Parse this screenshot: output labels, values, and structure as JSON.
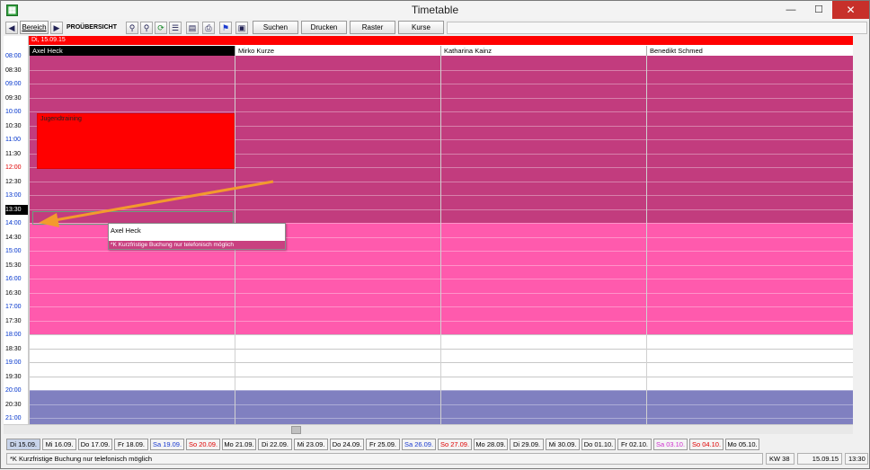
{
  "window": {
    "title": "Timetable",
    "icon": "app-grid-icon",
    "close_color": "#c7302a"
  },
  "toolbar": {
    "bereich": "Bereich",
    "mode": "PROÜBERSICHT",
    "suchen": "Suchen",
    "drucken": "Drucken",
    "raster": "Raster",
    "kurse": "Kurse",
    "icons": [
      "back-arrow-icon",
      "forward-arrow-icon",
      "zoom-in-icon",
      "zoom-out-icon",
      "refresh-icon",
      "list-icon",
      "calendar-icon",
      "print-icon",
      "filter-icon",
      "export-icon"
    ]
  },
  "grid": {
    "date": "Di, 15.09.15",
    "columns": [
      "Axel Heck",
      "Mirko Kurze",
      "Katharina Kainz",
      "Benedikt Schmed"
    ],
    "times": [
      "08:00",
      "08:30",
      "09:00",
      "09:30",
      "10:00",
      "10:30",
      "11:00",
      "11:30",
      "12:00",
      "12:30",
      "13:00",
      "13:30",
      "14:00",
      "14:30",
      "15:00",
      "15:30",
      "16:00",
      "16:30",
      "17:00",
      "17:30",
      "18:00",
      "18:30",
      "19:00",
      "19:30",
      "20:00",
      "20:30",
      "21:00"
    ],
    "event": {
      "title": "Jugendtraining",
      "start": "10:00",
      "end": "12:00",
      "column": "Axel Heck"
    },
    "colors": {
      "past": "#c23c7e",
      "open": "#ff5aad",
      "evening": "#8080c0",
      "event": "#ff0000",
      "date_bar": "#ff0000"
    }
  },
  "tooltip": {
    "title": "Axel Heck",
    "note": "*K Kurzfristige Buchung nur telefonisch möglich"
  },
  "days": [
    {
      "label": "Di 15.09.",
      "color": "#000000",
      "selected": true
    },
    {
      "label": "Mi 16.09.",
      "color": "#000000"
    },
    {
      "label": "Do 17.09.",
      "color": "#000000"
    },
    {
      "label": "Fr 18.09.",
      "color": "#000000"
    },
    {
      "label": "Sa 19.09.",
      "color": "#1a3ad0"
    },
    {
      "label": "So 20.09.",
      "color": "#e00000"
    },
    {
      "label": "Mo 21.09.",
      "color": "#000000"
    },
    {
      "label": "Di 22.09.",
      "color": "#000000"
    },
    {
      "label": "Mi 23.09.",
      "color": "#000000"
    },
    {
      "label": "Do 24.09.",
      "color": "#000000"
    },
    {
      "label": "Fr 25.09.",
      "color": "#000000"
    },
    {
      "label": "Sa 26.09.",
      "color": "#1a3ad0"
    },
    {
      "label": "So 27.09.",
      "color": "#e00000"
    },
    {
      "label": "Mo 28.09.",
      "color": "#000000"
    },
    {
      "label": "Di 29.09.",
      "color": "#000000"
    },
    {
      "label": "Mi 30.09.",
      "color": "#000000"
    },
    {
      "label": "Do 01.10.",
      "color": "#000000"
    },
    {
      "label": "Fr 02.10.",
      "color": "#000000"
    },
    {
      "label": "Sa 03.10.",
      "color": "#d030d0"
    },
    {
      "label": "So 04.10.",
      "color": "#e00000"
    },
    {
      "label": "Mo 05.10.",
      "color": "#000000"
    }
  ],
  "status": {
    "note": "*K Kurzfristige Buchung nur telefonisch möglich",
    "week": "KW 38",
    "date": "15.09.15",
    "time": "13:30"
  }
}
